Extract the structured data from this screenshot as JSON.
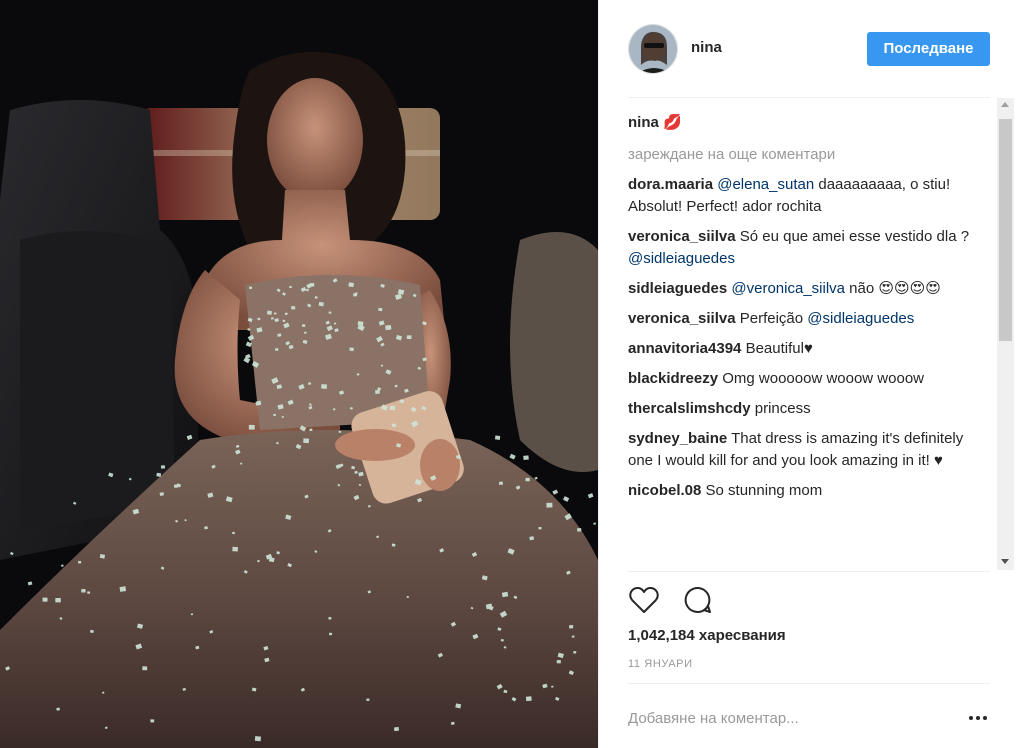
{
  "header": {
    "username": "nina",
    "follow_label": "Последване"
  },
  "caption": {
    "username": "nina",
    "text": "💋"
  },
  "load_more": "зареждане на още коментари",
  "comments": [
    {
      "user": "dora.maaria",
      "mention": "@elena_sutan",
      "text": " daaaaaaaaa, o stiu! Absolut! Perfect! ador rochita"
    },
    {
      "user": "veronica_siilva",
      "mention": "",
      "text": "Só eu que amei esse vestido dla ? ",
      "mention2": "@sidleiaguedes"
    },
    {
      "user": "sidleiaguedes",
      "mention": "@veronica_siilva",
      "text": " não 😍😍😍😍"
    },
    {
      "user": "veronica_siilva",
      "mention": "",
      "text": "Perfeição ",
      "mention2": "@sidleiaguedes"
    },
    {
      "user": "annavitoria4394",
      "mention": "",
      "text": "Beautiful♥"
    },
    {
      "user": "blackidreezy",
      "mention": "",
      "text": "Omg wooooow wooow wooow"
    },
    {
      "user": "thercalslimshcdy",
      "mention": "",
      "text": "princess"
    },
    {
      "user": "sydney_baine",
      "mention": "",
      "text": "That dress is amazing it's definitely one I would kill for and you look amazing in it! ♥"
    },
    {
      "user": "nicobel.08",
      "mention": "",
      "text": "So stunning mom"
    }
  ],
  "actions": {
    "like_icon": "heart-outline-icon",
    "comment_icon": "comment-bubble-icon"
  },
  "likes": {
    "count": "1,042,184",
    "label": "харесвания"
  },
  "date": "11 ЯНУАРИ",
  "add_comment": {
    "placeholder": "Добавяне на коментар..."
  },
  "colors": {
    "accent": "#3897f0",
    "mention": "#003569",
    "muted": "#999999",
    "text": "#262626"
  }
}
